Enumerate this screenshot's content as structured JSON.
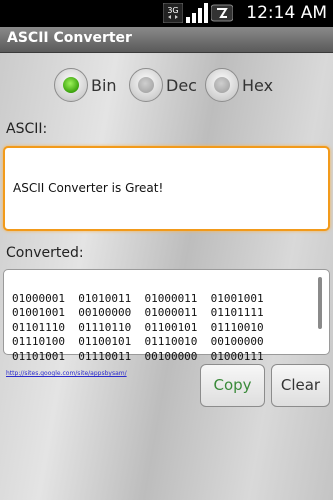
{
  "status_bar": {
    "time": "12:14 AM",
    "network_icon": "3g-icon",
    "signal_icon": "signal-icon",
    "battery_icon": "battery-icon",
    "network_label": "3G"
  },
  "app": {
    "title": "ASCII Converter"
  },
  "radios": [
    {
      "label": "Bin",
      "selected": true
    },
    {
      "label": "Dec",
      "selected": false
    },
    {
      "label": "Hex",
      "selected": false
    }
  ],
  "ascii": {
    "label": "ASCII:",
    "value": "ASCII Converter is Great!"
  },
  "converted": {
    "label": "Converted:",
    "lines": [
      "01000001  01010011  01000011  01001001",
      "01001001  00100000  01000011  01101111",
      "01101110  01110110  01100101  01110010",
      "01110100  01100101  01110010  00100000",
      "01101001  01110011  00100000  01000111"
    ]
  },
  "link_text": "http://sites.google.com/site/appsbysam/",
  "buttons": {
    "copy": "Copy",
    "clear": "Clear"
  },
  "colors": {
    "accent": "#f29a1a",
    "radio_selected": "#3aa20c",
    "copy_text": "#3a8a3a"
  }
}
